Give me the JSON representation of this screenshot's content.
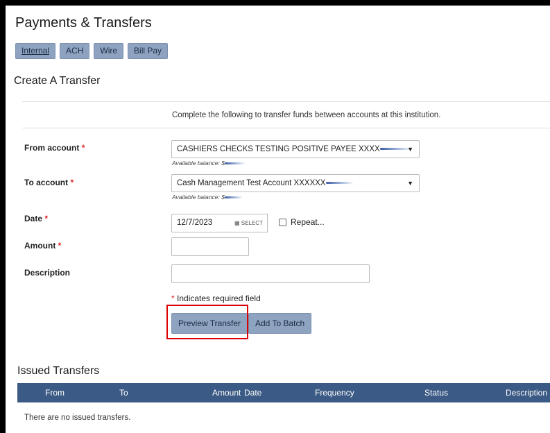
{
  "page": {
    "title": "Payments & Transfers",
    "tabs": [
      {
        "label": "Internal",
        "active": true
      },
      {
        "label": "ACH"
      },
      {
        "label": "Wire"
      },
      {
        "label": "Bill Pay"
      }
    ],
    "section_title": "Create A Transfer",
    "intro_text": "Complete the following to transfer funds between accounts at this institution."
  },
  "form": {
    "from_label": "From account",
    "from_value": "CASHIERS CHECKS TESTING POSITIVE PAYEE XXXX",
    "from_available": "Available balance: $",
    "to_label": "To account",
    "to_value": "Cash Management Test Account XXXXXX",
    "to_available": "Available balance: $",
    "date_label": "Date",
    "date_value": "12/7/2023",
    "date_button": "SELECT",
    "repeat_label": "Repeat...",
    "amount_label": "Amount",
    "amount_value": "",
    "description_label": "Description",
    "description_value": "",
    "required_marker": "*",
    "required_note": "Indicates required field",
    "preview_button": "Preview Transfer",
    "batch_button": "Add To Batch"
  },
  "issued": {
    "title": "Issued Transfers",
    "columns": [
      "From",
      "To",
      "Amount",
      "Date",
      "Frequency",
      "Status",
      "Description"
    ],
    "empty_text": "There are no issued transfers."
  },
  "icons": {
    "dropdown": "caret-down-icon",
    "calendar": "calendar-icon"
  },
  "colors": {
    "button_bg": "#8ea3bf",
    "table_header_bg": "#3b5a85",
    "required": "#dd2222",
    "highlight": "#dd0000"
  }
}
